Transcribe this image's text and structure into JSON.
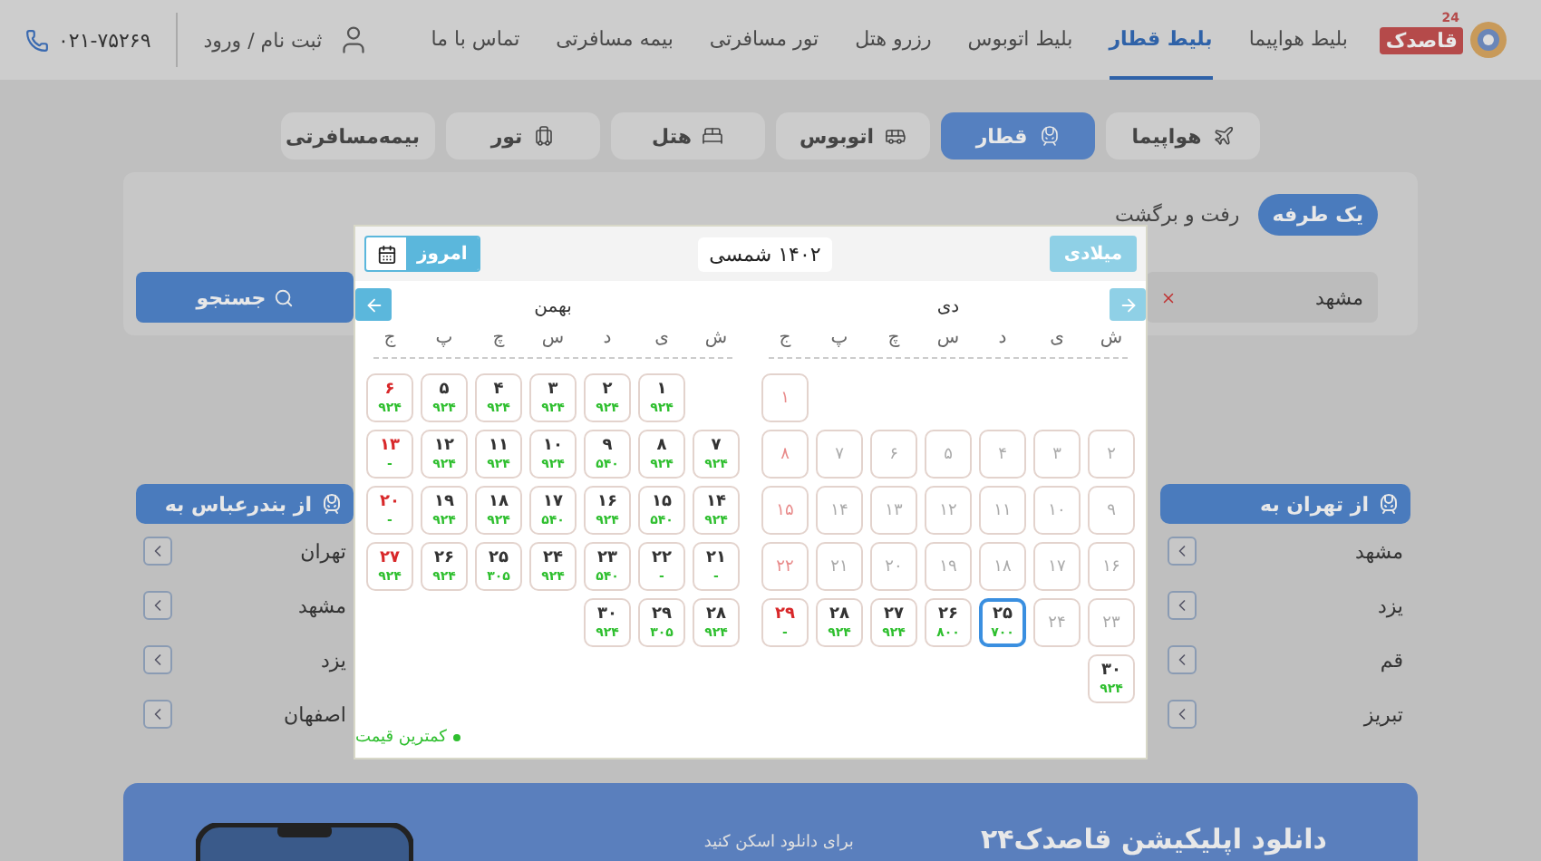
{
  "header": {
    "logo": {
      "text": "قاصدک",
      "badge": "24"
    },
    "nav": [
      {
        "label": "بلیط هواپیما",
        "selected": false
      },
      {
        "label": "بلیط قطار",
        "selected": true
      },
      {
        "label": "بلیط اتوبوس",
        "selected": false
      },
      {
        "label": "رزرو هتل",
        "selected": false
      },
      {
        "label": "تور مسافرتی",
        "selected": false
      },
      {
        "label": "بیمه مسافرتی",
        "selected": false
      },
      {
        "label": "تماس با ما",
        "selected": false
      }
    ],
    "login": "ثبت نام / ورود",
    "phone": "۰۲۱-۷۵۲۶۹"
  },
  "service_tabs": [
    {
      "kind": "plane",
      "label": "هواپیما",
      "selected": false
    },
    {
      "kind": "train",
      "label": "قطار",
      "selected": true
    },
    {
      "kind": "bus",
      "label": "اتوبوس",
      "selected": false
    },
    {
      "kind": "hotel",
      "label": "هتل",
      "selected": false
    },
    {
      "kind": "tour",
      "label": "تور",
      "selected": false
    },
    {
      "kind": "insurance",
      "label": "بیمه‌مسافرتی",
      "selected": false
    }
  ],
  "search": {
    "trip_types": [
      {
        "label": "یک طرفه",
        "selected": true
      },
      {
        "label": "رفت و برگشت",
        "selected": false
      }
    ],
    "origin": "مشهد",
    "button": "جستجو"
  },
  "routes": [
    {
      "title": "از تهران به",
      "items": [
        "مشهد",
        "یزد",
        "قم",
        "تبریز"
      ]
    },
    {
      "title": "از بندرعباس به",
      "items": [
        "تهران",
        "مشهد",
        "یزد",
        "اصفهان"
      ]
    }
  ],
  "banner": {
    "title": "دانلود اپلیکیشن قاصدک۲۴",
    "scan_hint": "برای دانلود اسکن کنید"
  },
  "calendar": {
    "today_button": "امروز",
    "year_label": "۱۴۰۲ شمسی",
    "gregorian_button": "میلادی",
    "legend": "کمترین قیمت",
    "months": [
      {
        "name": "دی",
        "weekdays": [
          "ش",
          "ی",
          "د",
          "س",
          "چ",
          "پ",
          "ج"
        ],
        "weeks": [
          [
            {
              "day": "۱",
              "disabled": true,
              "holiday": true,
              "selected": false
            }
          ],
          [
            {
              "day": "۲",
              "disabled": true,
              "holiday": false,
              "selected": false
            },
            {
              "day": "۳",
              "disabled": true,
              "holiday": false,
              "selected": false
            },
            {
              "day": "۴",
              "disabled": true,
              "holiday": false,
              "selected": false
            },
            {
              "day": "۵",
              "disabled": true,
              "holiday": false,
              "selected": false
            },
            {
              "day": "۶",
              "disabled": true,
              "holiday": false,
              "selected": false
            },
            {
              "day": "۷",
              "disabled": true,
              "holiday": false,
              "selected": false
            },
            {
              "day": "۸",
              "disabled": true,
              "holiday": true,
              "selected": false
            }
          ],
          [
            {
              "day": "۹",
              "disabled": true,
              "holiday": false,
              "selected": false
            },
            {
              "day": "۱۰",
              "disabled": true,
              "holiday": false,
              "selected": false
            },
            {
              "day": "۱۱",
              "disabled": true,
              "holiday": false,
              "selected": false
            },
            {
              "day": "۱۲",
              "disabled": true,
              "holiday": false,
              "selected": false
            },
            {
              "day": "۱۳",
              "disabled": true,
              "holiday": false,
              "selected": false
            },
            {
              "day": "۱۴",
              "disabled": true,
              "holiday": false,
              "selected": false
            },
            {
              "day": "۱۵",
              "disabled": true,
              "holiday": true,
              "selected": false
            }
          ],
          [
            {
              "day": "۱۶",
              "disabled": true,
              "holiday": false,
              "selected": false
            },
            {
              "day": "۱۷",
              "disabled": true,
              "holiday": false,
              "selected": false
            },
            {
              "day": "۱۸",
              "disabled": true,
              "holiday": false,
              "selected": false
            },
            {
              "day": "۱۹",
              "disabled": true,
              "holiday": false,
              "selected": false
            },
            {
              "day": "۲۰",
              "disabled": true,
              "holiday": false,
              "selected": false
            },
            {
              "day": "۲۱",
              "disabled": true,
              "holiday": false,
              "selected": false
            },
            {
              "day": "۲۲",
              "disabled": true,
              "holiday": true,
              "selected": false
            }
          ],
          [
            {
              "day": "۲۳",
              "disabled": true,
              "holiday": false,
              "selected": false
            },
            {
              "day": "۲۴",
              "disabled": true,
              "holiday": false,
              "selected": false
            },
            {
              "day": "۲۵",
              "price": "۷۰۰",
              "disabled": false,
              "holiday": false,
              "selected": true
            },
            {
              "day": "۲۶",
              "price": "۸۰۰",
              "disabled": false,
              "holiday": false,
              "selected": false
            },
            {
              "day": "۲۷",
              "price": "۹۲۴",
              "disabled": false,
              "holiday": false,
              "selected": false
            },
            {
              "day": "۲۸",
              "price": "۹۲۴",
              "disabled": false,
              "holiday": false,
              "selected": false
            },
            {
              "day": "۲۹",
              "price": "-",
              "disabled": false,
              "holiday": true,
              "selected": false
            }
          ],
          [
            {
              "day": "۳۰",
              "price": "۹۲۴",
              "disabled": false,
              "holiday": false,
              "selected": false
            }
          ]
        ]
      },
      {
        "name": "بهمن",
        "weekdays": [
          "ش",
          "ی",
          "د",
          "س",
          "چ",
          "پ",
          "ج"
        ],
        "weeks": [
          [
            {
              "day": "۱",
              "price": "۹۲۴",
              "disabled": false,
              "holiday": false,
              "selected": false
            },
            {
              "day": "۲",
              "price": "۹۲۴",
              "disabled": false,
              "holiday": false,
              "selected": false
            },
            {
              "day": "۳",
              "price": "۹۲۴",
              "disabled": false,
              "holiday": false,
              "selected": false
            },
            {
              "day": "۴",
              "price": "۹۲۴",
              "disabled": false,
              "holiday": false,
              "selected": false
            },
            {
              "day": "۵",
              "price": "۹۲۴",
              "disabled": false,
              "holiday": false,
              "selected": false
            },
            {
              "day": "۶",
              "price": "۹۲۴",
              "disabled": false,
              "holiday": true,
              "selected": false
            }
          ],
          [
            {
              "day": "۷",
              "price": "۹۲۴",
              "disabled": false,
              "holiday": false,
              "selected": false
            },
            {
              "day": "۸",
              "price": "۹۲۴",
              "disabled": false,
              "holiday": false,
              "selected": false
            },
            {
              "day": "۹",
              "price": "۵۴۰",
              "disabled": false,
              "holiday": false,
              "selected": false
            },
            {
              "day": "۱۰",
              "price": "۹۲۴",
              "disabled": false,
              "holiday": false,
              "selected": false
            },
            {
              "day": "۱۱",
              "price": "۹۲۴",
              "disabled": false,
              "holiday": false,
              "selected": false
            },
            {
              "day": "۱۲",
              "price": "۹۲۴",
              "disabled": false,
              "holiday": false,
              "selected": false
            },
            {
              "day": "۱۳",
              "price": "-",
              "disabled": false,
              "holiday": true,
              "selected": false
            }
          ],
          [
            {
              "day": "۱۴",
              "price": "۹۲۴",
              "disabled": false,
              "holiday": false,
              "selected": false
            },
            {
              "day": "۱۵",
              "price": "۵۴۰",
              "disabled": false,
              "holiday": false,
              "selected": false
            },
            {
              "day": "۱۶",
              "price": "۹۲۴",
              "disabled": false,
              "holiday": false,
              "selected": false
            },
            {
              "day": "۱۷",
              "price": "۵۴۰",
              "disabled": false,
              "holiday": false,
              "selected": false
            },
            {
              "day": "۱۸",
              "price": "۹۲۴",
              "disabled": false,
              "holiday": false,
              "selected": false
            },
            {
              "day": "۱۹",
              "price": "۹۲۴",
              "disabled": false,
              "holiday": false,
              "selected": false
            },
            {
              "day": "۲۰",
              "price": "-",
              "disabled": false,
              "holiday": true,
              "selected": false
            }
          ],
          [
            {
              "day": "۲۱",
              "price": "-",
              "disabled": false,
              "holiday": false,
              "selected": false
            },
            {
              "day": "۲۲",
              "price": "-",
              "disabled": false,
              "holiday": false,
              "selected": false
            },
            {
              "day": "۲۳",
              "price": "۵۴۰",
              "disabled": false,
              "holiday": false,
              "selected": false
            },
            {
              "day": "۲۴",
              "price": "۹۲۴",
              "disabled": false,
              "holiday": false,
              "selected": false
            },
            {
              "day": "۲۵",
              "price": "۳۰۵",
              "disabled": false,
              "holiday": false,
              "selected": false
            },
            {
              "day": "۲۶",
              "price": "۹۲۴",
              "disabled": false,
              "holiday": false,
              "selected": false
            },
            {
              "day": "۲۷",
              "price": "۹۲۴",
              "disabled": false,
              "holiday": true,
              "selected": false
            }
          ],
          [
            {
              "day": "۲۸",
              "price": "۹۲۴",
              "disabled": false,
              "holiday": false,
              "selected": false
            },
            {
              "day": "۲۹",
              "price": "۳۰۵",
              "disabled": false,
              "holiday": false,
              "selected": false
            },
            {
              "day": "۳۰",
              "price": "۹۲۴",
              "disabled": false,
              "holiday": false,
              "selected": false
            }
          ]
        ]
      }
    ]
  }
}
